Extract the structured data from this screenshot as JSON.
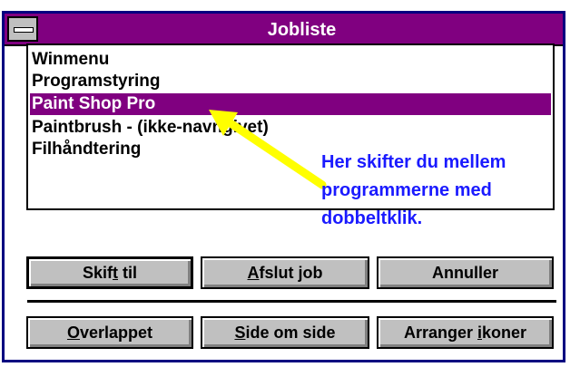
{
  "window": {
    "title": "Jobliste"
  },
  "list": {
    "items": [
      {
        "label": "Winmenu",
        "selected": false
      },
      {
        "label": "Programstyring",
        "selected": false
      },
      {
        "label": "Paint Shop Pro",
        "selected": true
      },
      {
        "label": "Paintbrush - (ikke-navngivet)",
        "selected": false
      },
      {
        "label": "Filhåndtering",
        "selected": false
      }
    ]
  },
  "annotation": {
    "lines": [
      "Her skifter du mellem",
      "programmerne med",
      "dobbeltklik."
    ],
    "color": "#1a1aff",
    "arrow_color": "#ffff00"
  },
  "buttons": {
    "row1": [
      {
        "label": "Skift til",
        "mnemonic": "t"
      },
      {
        "label": "Afslut job",
        "mnemonic": "A"
      },
      {
        "label": "Annuller",
        "mnemonic": ""
      }
    ],
    "row2": [
      {
        "label": "Overlappet",
        "mnemonic": "O"
      },
      {
        "label": "Side om side",
        "mnemonic": "S"
      },
      {
        "label": "Arranger ikoner",
        "mnemonic": "i"
      }
    ]
  },
  "colors": {
    "titlebar": "#800080",
    "selection": "#800080",
    "frame": "#000080",
    "button_face": "#c0c0c0"
  }
}
